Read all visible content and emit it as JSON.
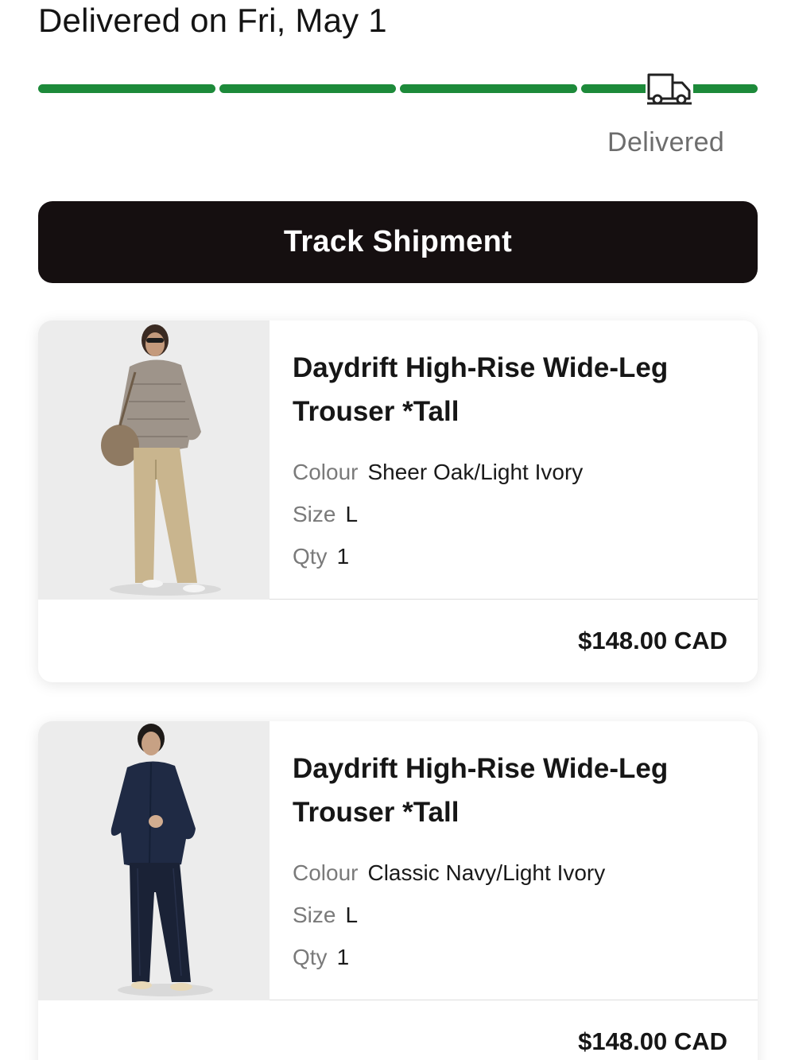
{
  "header": {
    "status_title": "Delivered on Fri, May 1",
    "status_label": "Delivered",
    "progress_fraction": 1.0,
    "progress_color": "#1d8a3a",
    "status_icon": "truck-icon"
  },
  "actions": {
    "track_label": "Track Shipment"
  },
  "items": [
    {
      "name": "Daydrift High-Rise Wide-Leg Trouser *Tall",
      "colour_label": "Colour",
      "colour": "Sheer Oak/Light Ivory",
      "size_label": "Size",
      "size": "L",
      "qty_label": "Qty",
      "qty": "1",
      "price": "$148.00 CAD"
    },
    {
      "name": "Daydrift High-Rise Wide-Leg Trouser *Tall",
      "colour_label": "Colour",
      "colour": "Classic Navy/Light Ivory",
      "size_label": "Size",
      "size": "L",
      "qty_label": "Qty",
      "qty": "1",
      "price": "$148.00 CAD"
    }
  ]
}
